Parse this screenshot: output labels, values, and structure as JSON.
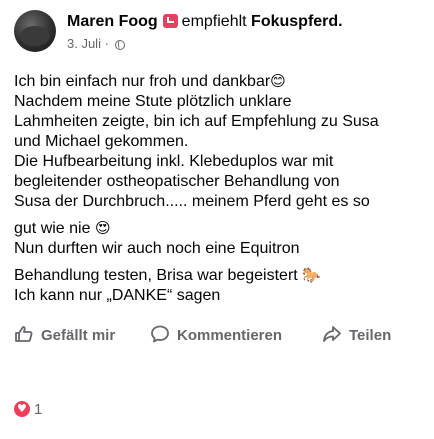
{
  "post": {
    "author": "Maren Foog",
    "verb": "empfiehlt",
    "page": "Fokuspferd.",
    "date": "3. Juli",
    "separator": "·",
    "lines": [
      "Ich bin einfach nur froh und dankbar",
      "Nachdem meine Stute plötzlich unklare",
      "Lahmheiten zeigte, bin ich auf Empfehlung zu Susa",
      "und Michael gekommen.",
      "Die Hufbearbeitung inkl. Klebeduplos war mit",
      "begleitender ostheopatischer Behandlung  von",
      "Susa der Durchbruch..... meinem Pferd geht es so",
      "gut wie nie",
      "Nun durften wir auch noch eine  Equitron",
      "Behandlung testen, Brisa war begeistert",
      "Ich kann nur „DANKE“ sagen"
    ],
    "emojis": {
      "line1": "😊",
      "line8": "😍",
      "line10": "🐎"
    }
  },
  "actions": {
    "like_label": "Gefällt mir",
    "comment_label": "Kommentieren",
    "share_label": "Teilen"
  },
  "reactions": {
    "count": "1"
  },
  "icons": {
    "avatar": "profile-picture",
    "recommend": "recommend-badge-icon",
    "privacy": "globe-icon",
    "like": "thumbs-up-icon",
    "comment": "comment-bubble-icon",
    "share": "share-arrow-icon",
    "reaction": "heart-reaction-icon"
  },
  "colors": {
    "text": "#050505",
    "secondary": "#65676b",
    "recommend": "#e4405f",
    "heart": "#f33e58"
  }
}
